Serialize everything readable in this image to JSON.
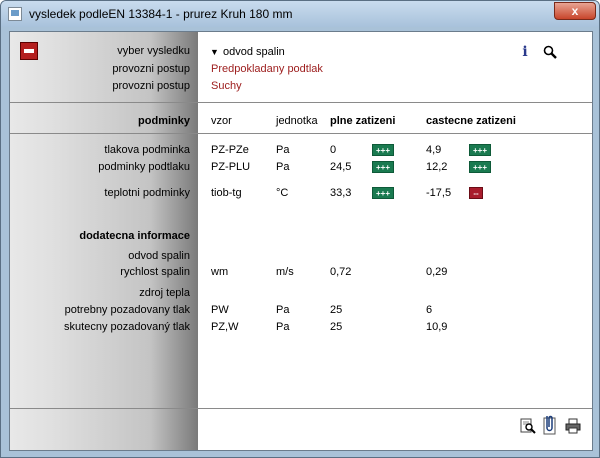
{
  "window": {
    "title": "vysledek podleEN 13384-1 - prurez Kruh 180 mm",
    "close_label": "x"
  },
  "top": {
    "vyber_label": "vyber vysledku",
    "vyber_value": "odvod spalin",
    "dropdown_arrow": "▼",
    "postup1_label": "provozni postup",
    "postup1_value": "Predpokladany podtlak",
    "postup2_label": "provozni postup",
    "postup2_value": "Suchy"
  },
  "header": {
    "podminky": "podminky",
    "vzor": "vzor",
    "jednotka": "jednotka",
    "plne": "plne zatizeni",
    "castecne": "castecne zatizeni"
  },
  "conditions": [
    {
      "label": "tlakova podminka",
      "vzor": "PZ-PZe",
      "unit": "Pa",
      "plne": "0",
      "plne_badge": "+++",
      "castecne": "4,9",
      "castecne_badge": "+++",
      "plne_status": "good",
      "castecne_status": "good"
    },
    {
      "label": "podminky podtlaku",
      "vzor": "PZ-PLU",
      "unit": "Pa",
      "plne": "24,5",
      "plne_badge": "+++",
      "castecne": "12,2",
      "castecne_badge": "+++",
      "plne_status": "good",
      "castecne_status": "good"
    },
    {
      "label": "teplotni podminky",
      "vzor": "tiob-tg",
      "unit": "°C",
      "plne": "33,3",
      "plne_badge": "+++",
      "castecne": "-17,5",
      "castecne_badge": "--",
      "plne_status": "good",
      "castecne_status": "bad"
    }
  ],
  "extra": {
    "title": "dodatecna informace",
    "odvod_label": "odvod spalin",
    "rychlost": {
      "label": "rychlost spalin",
      "vzor": "wm",
      "unit": "m/s",
      "plne": "0,72",
      "castecne": "0,29"
    },
    "zdroj_label": "zdroj tepla",
    "potrebny": {
      "label": "potrebny pozadovany tlak",
      "vzor": "PW",
      "unit": "Pa",
      "plne": "25",
      "castecne": "6"
    },
    "skutecny": {
      "label": "skutecny pozadovaný tlak",
      "vzor": "PZ,W",
      "unit": "Pa",
      "plne": "25",
      "castecne": "10,9"
    }
  },
  "icons": {
    "info": "info-icon",
    "search": "search-icon",
    "preview": "print-preview-icon",
    "attach": "paperclip-icon",
    "print": "printer-icon"
  },
  "colors": {
    "good": "#1a7a50",
    "bad": "#a81c2c",
    "accent_red": "#9c1c1c"
  }
}
